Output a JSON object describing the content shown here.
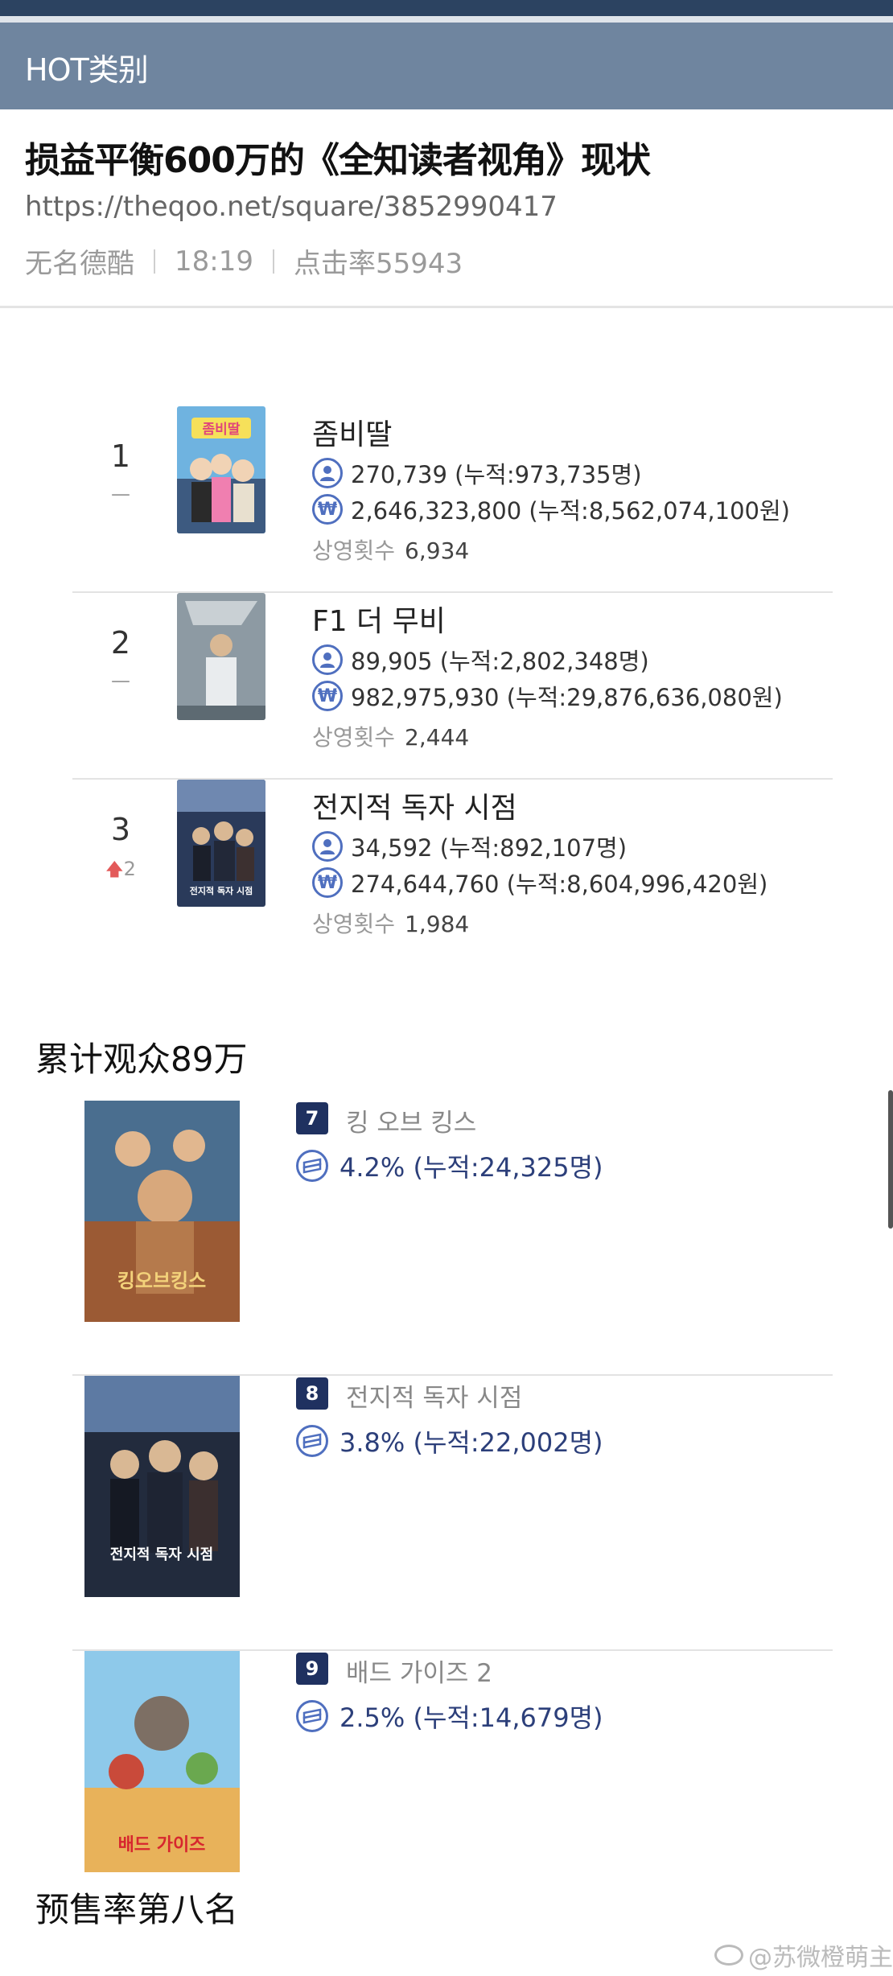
{
  "header": {
    "category": "HOT类别",
    "title": "损益平衡600万的《全知读者视角》现状",
    "url": "https://theqoo.net/square/3852990417",
    "author": "无名德酷",
    "time": "18:19",
    "views": "点击率55943"
  },
  "box_office": [
    {
      "rank": "1",
      "change": "—",
      "title": "좀비딸",
      "audience": "270,739 (누적:973,735명)",
      "revenue": "2,646,323,800 (누적:8,562,074,100원)",
      "screen_label": "상영횟수",
      "screens": "6,934",
      "poster_text": "좀비딸",
      "poster_icon": "poster-zombie-daughter"
    },
    {
      "rank": "2",
      "change": "—",
      "title": "F1 더 무비",
      "audience": "89,905 (누적:2,802,348명)",
      "revenue": "982,975,930 (누적:29,876,636,080원)",
      "screen_label": "상영횟수",
      "screens": "2,444",
      "poster_icon": "poster-f1"
    },
    {
      "rank": "3",
      "change_icon": "arrow-up-icon",
      "change": "2",
      "title": "전지적 독자 시점",
      "audience": "34,592 (누적:892,107명)",
      "revenue": "274,644,760 (누적:8,604,996,420원)",
      "screen_label": "상영횟수",
      "screens": "1,984",
      "poster_text": "전지적 독자 시점",
      "poster_icon": "poster-omniscient-reader"
    }
  ],
  "caption_1": "累计观众89万",
  "presales": [
    {
      "rank": "7",
      "title": "킹 오브 킹스",
      "rate": "4.2% (누적:24,325명)",
      "poster_text": "킹오브킹스"
    },
    {
      "rank": "8",
      "title": "전지적 독자 시점",
      "rate": "3.8% (누적:22,002명)",
      "poster_text": "전지적 독자 시점"
    },
    {
      "rank": "9",
      "title": "배드 가이즈 2",
      "rate": "2.5% (누적:14,679명)",
      "poster_text": "배드 가이즈"
    }
  ],
  "caption_2": "预售率第八名",
  "watermark": "@苏微橙萌主",
  "colors": {
    "top_bar": "#2c4361",
    "category_bar": "#6f859f",
    "icon_blue": "#4f6fbf",
    "badge_navy": "#1f3160",
    "up_red": "#e35a5a"
  }
}
